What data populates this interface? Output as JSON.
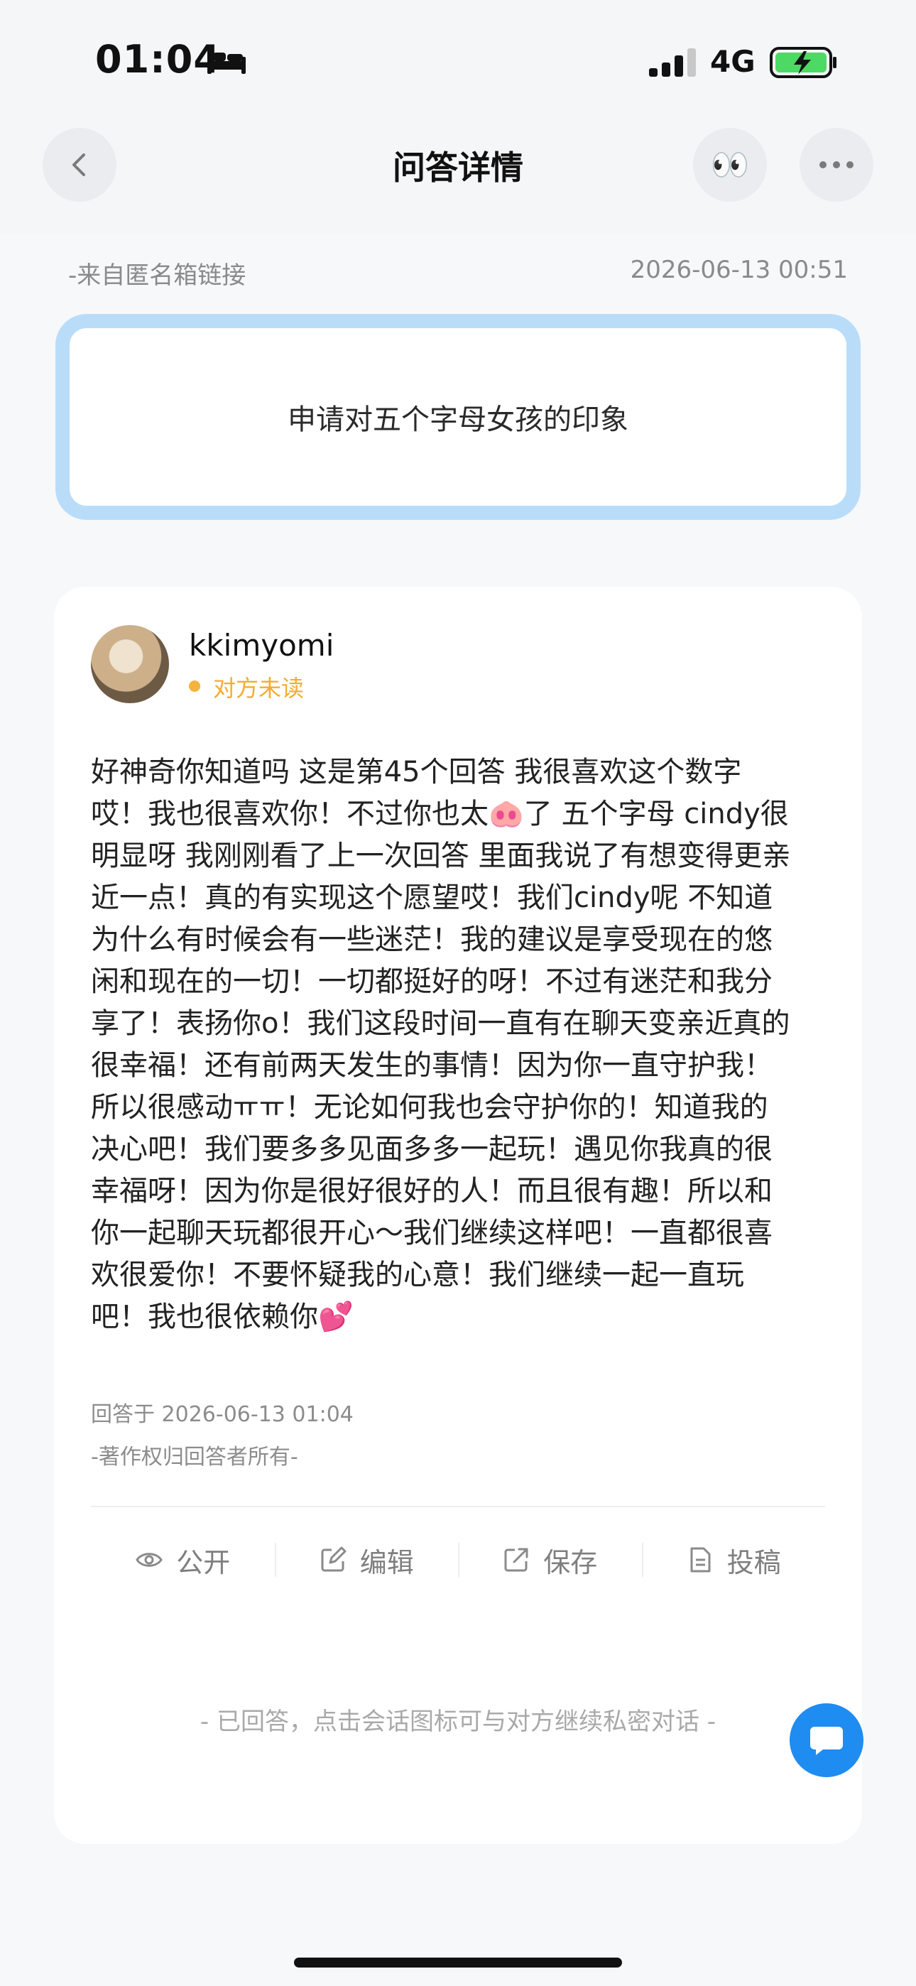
{
  "status_bar": {
    "time": "01:04",
    "network": "4G",
    "icons": [
      "bed-icon",
      "signal-icon",
      "battery-charging-icon"
    ]
  },
  "nav": {
    "title": "问答详情",
    "back_icon": "chevron-left-icon",
    "eyes_emoji": "👀",
    "more_icon": "more-dots-icon"
  },
  "question": {
    "source": "-来自匿名箱链接",
    "datetime": "2026-06-13 00:51",
    "text": "申请对五个字母女孩的印象"
  },
  "answer": {
    "username": "kkimyomi",
    "status": "对方未读",
    "body": "好神奇你知道吗 这是第45个回答 我很喜欢这个数字\n哎！我也很喜欢你！不过你也太🐽了 五个字母 cindy很\n明显呀 我刚刚看了上一次回答 里面我说了有想变得更亲\n近一点！真的有实现这个愿望哎！我们cindy呢 不知道\n为什么有时候会有一些迷茫！我的建议是享受现在的悠\n闲和现在的一切！一切都挺好的呀！不过有迷茫和我分\n享了！表扬你o！我们这段时间一直有在聊天变亲近真的\n很幸福！还有前两天发生的事情！因为你一直守护我！\n所以很感动ㅠㅠ！无论如何我也会守护你的！知道我的\n决心吧！我们要多多见面多多一起玩！遇见你我真的很\n幸福呀！因为你是很好很好的人！而且很有趣！所以和\n你一起聊天玩都很开心～我们继续这样吧！一直都很喜\n欢很爱你！不要怀疑我的心意！我们继续一起一直玩\n吧！我也很依赖你💕",
    "answered_at": "回答于 2026-06-13 01:04",
    "copyright": "-著作权归回答者所有-"
  },
  "actions": [
    {
      "label": "公开",
      "icon": "eye-icon"
    },
    {
      "label": "编辑",
      "icon": "edit-icon"
    },
    {
      "label": "保存",
      "icon": "share-export-icon"
    },
    {
      "label": "投稿",
      "icon": "document-icon"
    }
  ],
  "footer": {
    "note": "- 已回答，点击会话图标可与对方继续私密对话 -",
    "fab_icon": "chat-bubble-icon"
  },
  "colors": {
    "question_border": "#b9ddf9",
    "unread_accent": "#f5ac2e",
    "fab_blue": "#1e8cf0",
    "battery_green": "#4cd964"
  }
}
